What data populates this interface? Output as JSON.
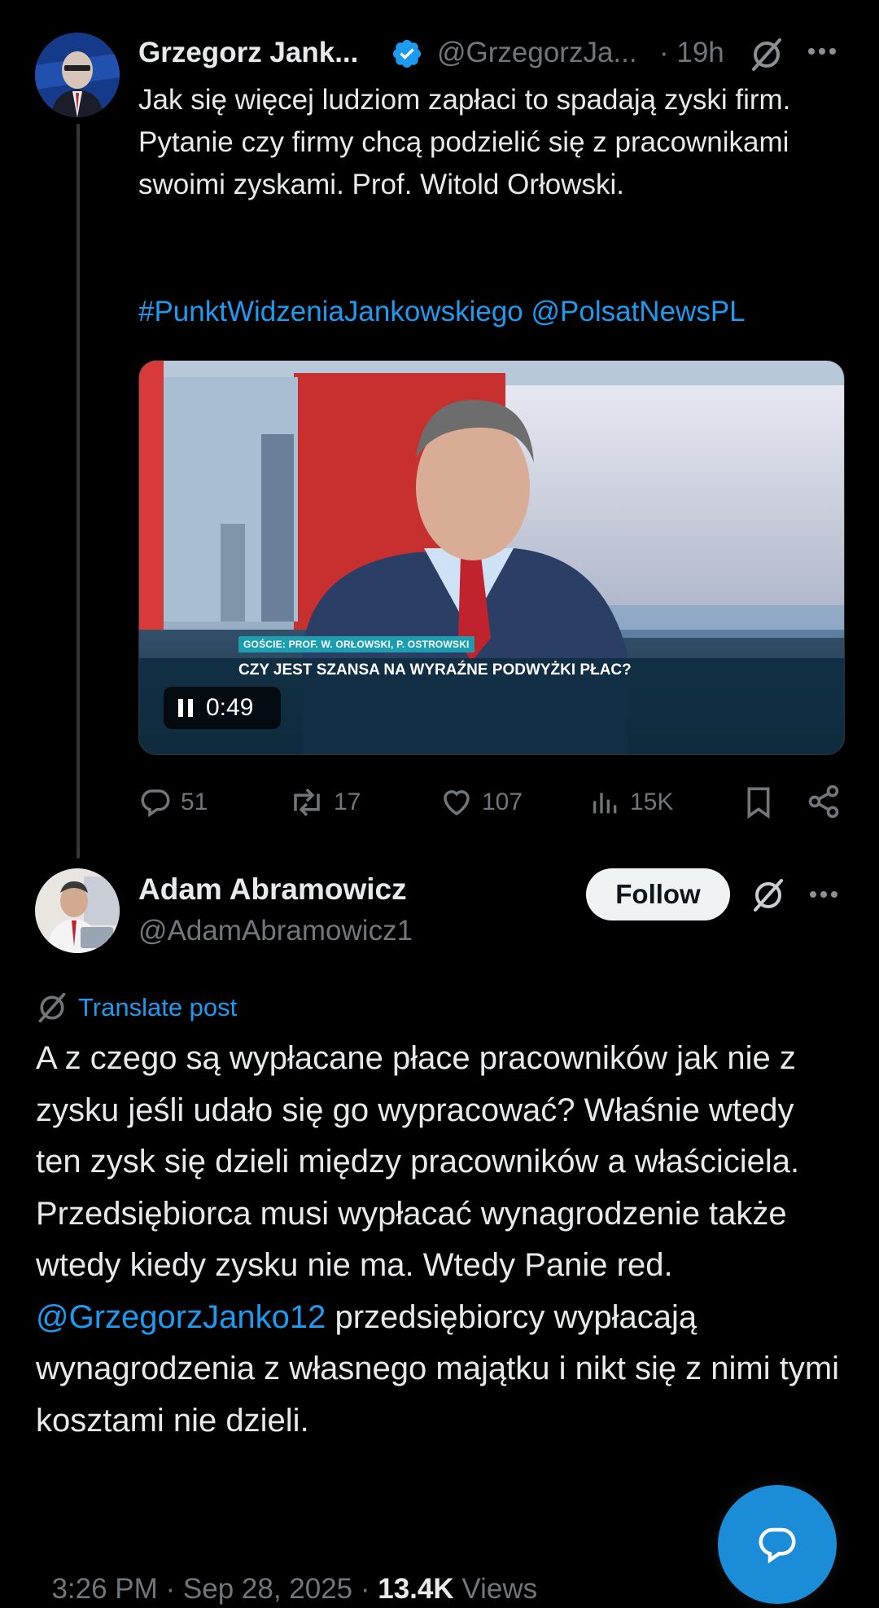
{
  "original_post": {
    "author_name": "Grzegorz Jank...",
    "handle": "@GrzegorzJa...",
    "time": "· 19h",
    "text": "Jak się więcej ludziom zapłaci to spadają zyski firm. Pytanie czy firmy chcą podzielić się z pracownikami swoimi zyskami. Prof. Witold Orłowski.",
    "hashtag": "#PunktWidzeniaJankowskiego",
    "mention": "@PolsatNewsPL",
    "video": {
      "guests_caption": "GOŚCIE: PROF. W. ORŁOWSKI, P. OSTROWSKI",
      "headline": "CZY JEST SZANSA NA WYRAŹNE PODWYŻKI PŁAC?",
      "duration": "0:49",
      "state_icon": "pause-icon"
    },
    "actions": {
      "replies": "51",
      "reposts": "17",
      "likes": "107",
      "views": "15K"
    }
  },
  "reply": {
    "author_name": "Adam Abramowicz",
    "handle": "@AdamAbramowicz1",
    "follow_label": "Follow",
    "translate_label": "Translate post",
    "text_part1": "A z czego są wypłacane płace pracowników jak nie z zysku jeśli udało się go wypracować? Właśnie wtedy ten zysk się dzieli między pracowników a właściciela.  Przedsiębiorca musi wypłacać wynagrodzenie także wtedy kiedy zysku nie ma. Wtedy Panie red.",
    "mention": "@GrzegorzJanko12",
    "text_part2": " przedsiębiorcy wypłacają wynagrodzenia z własnego majątku i nikt się z nimi tymi kosztami nie dzieli.",
    "meta_time": "3:26 PM · Sep 28, 2025 · ",
    "meta_views_count": "13.4K",
    "meta_views_label": " Views"
  },
  "colors": {
    "background": "#000000",
    "text": "#e7e9ea",
    "muted": "#71767b",
    "accent": "#1d9bf0",
    "verified": "#1d9bf0"
  }
}
